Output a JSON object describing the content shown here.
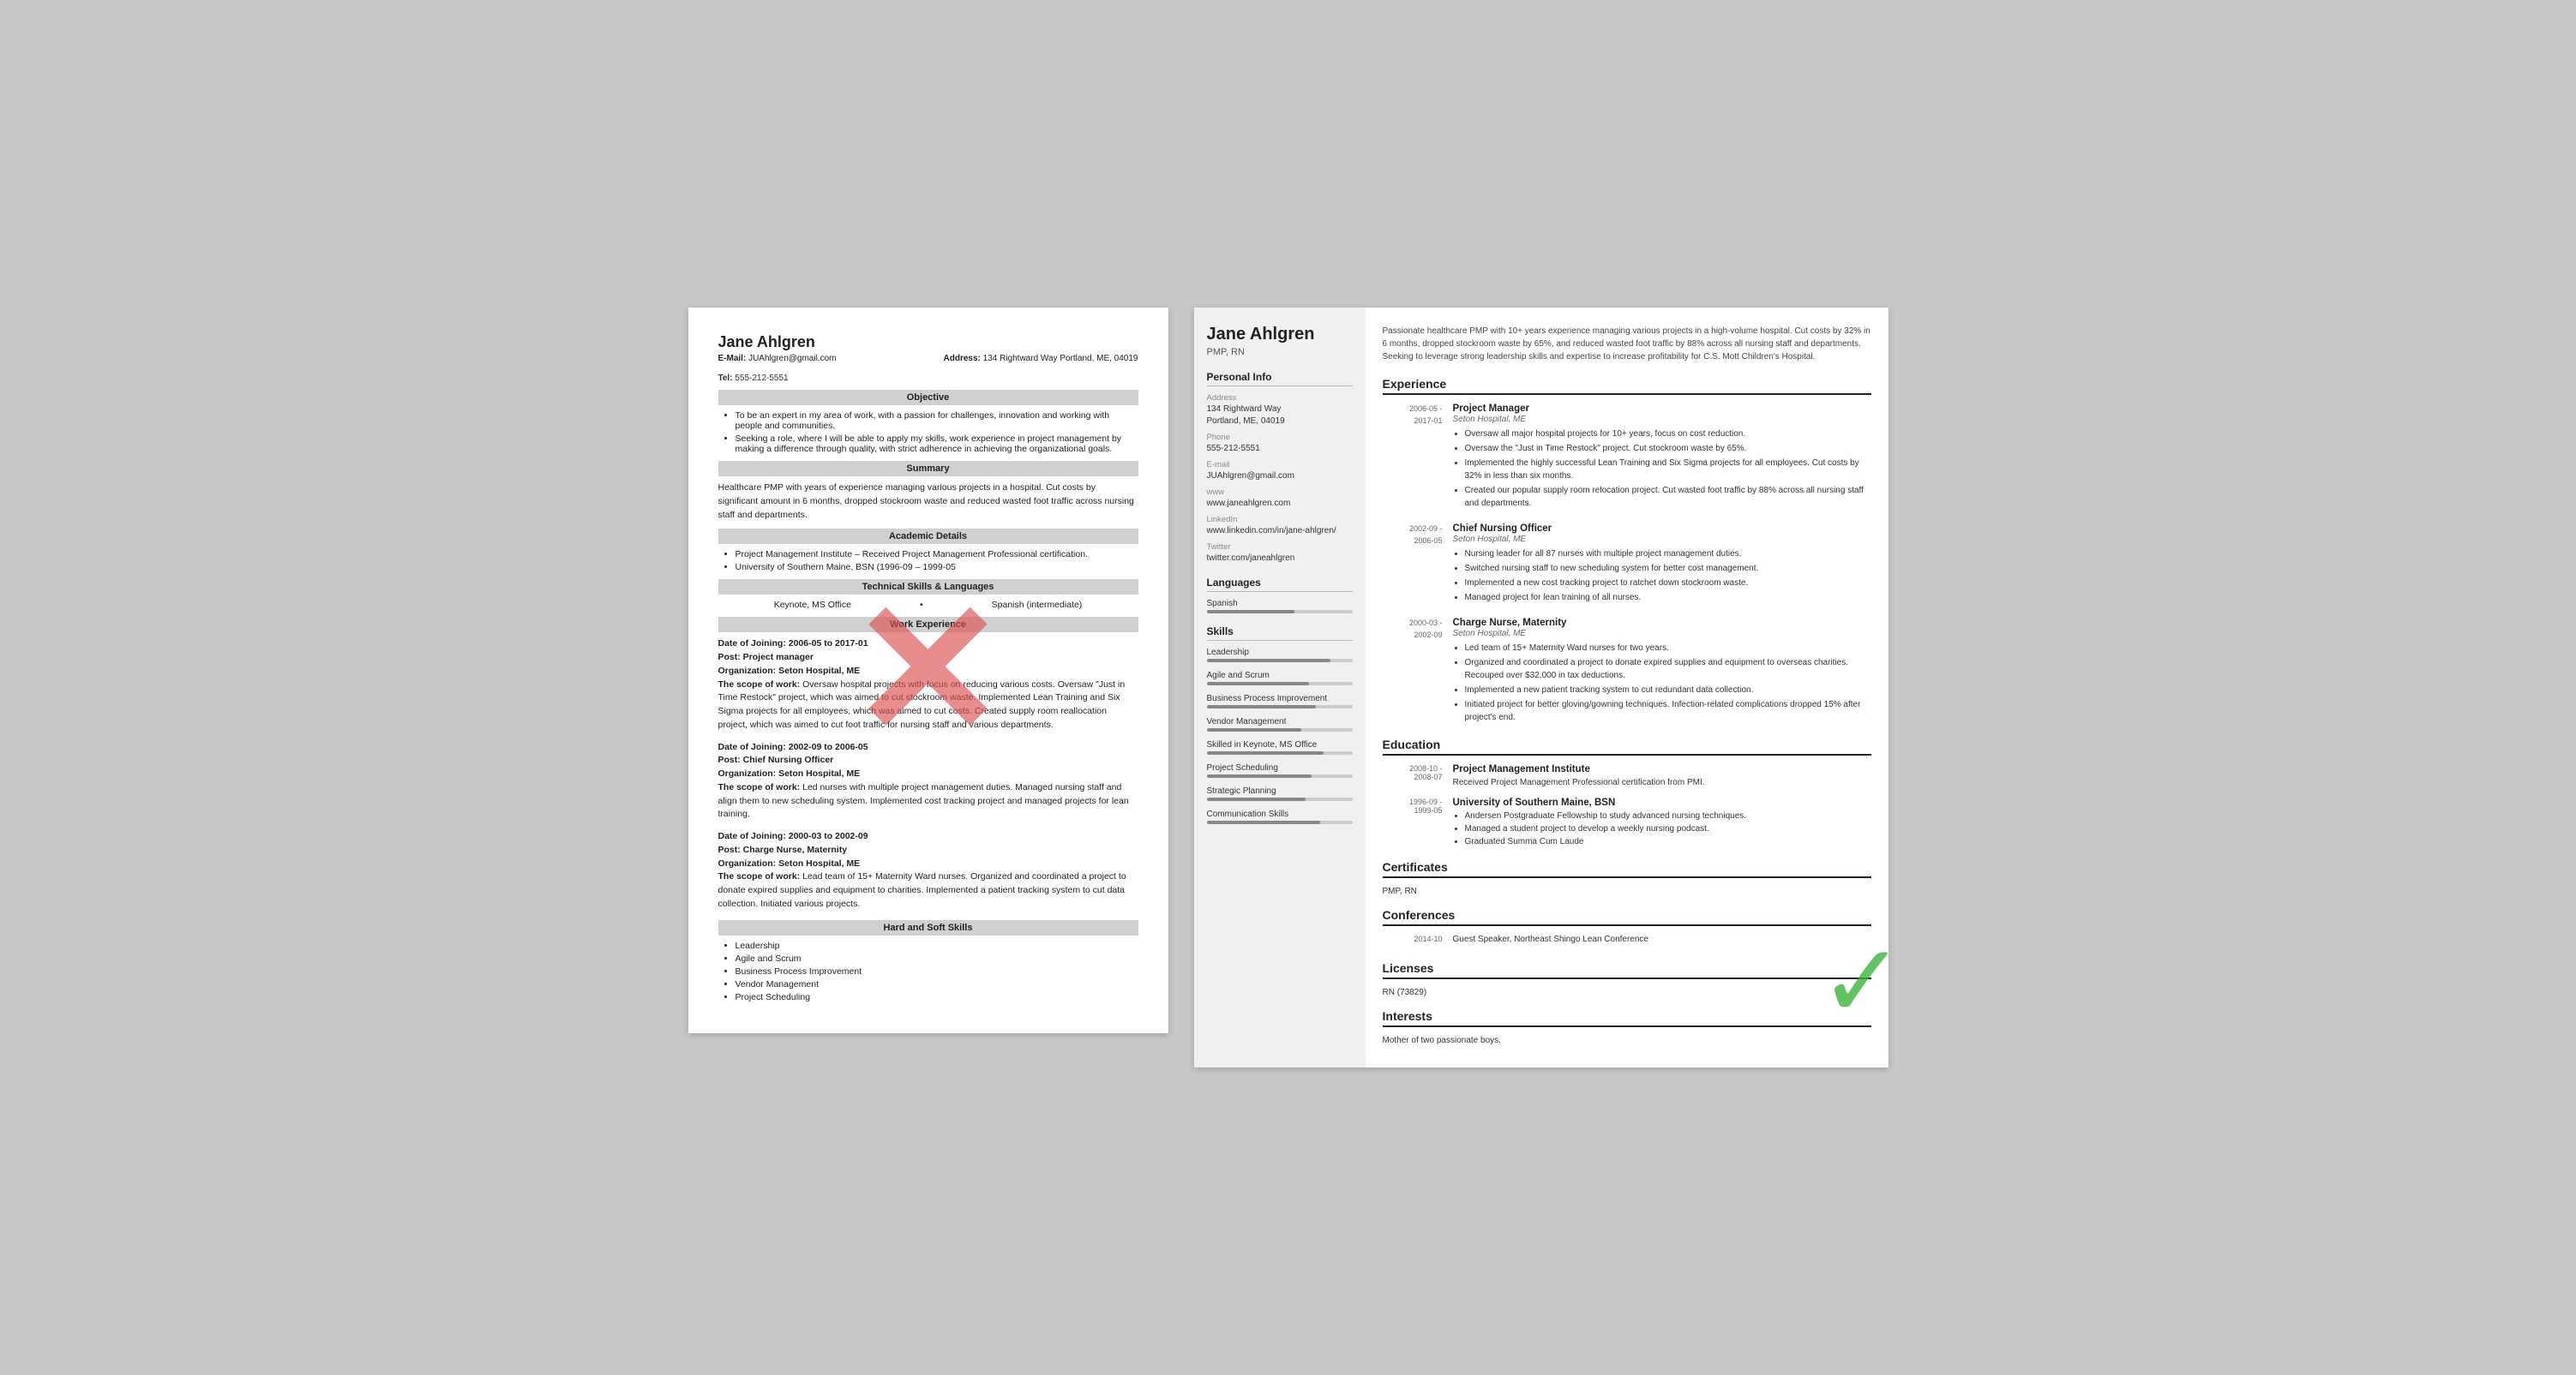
{
  "left_resume": {
    "name": "Jane Ahlgren",
    "email_label": "E-Mail:",
    "email": "JUAhlgren@gmail.com",
    "address_label": "Address:",
    "address": "134 Rightward Way Portland, ME, 04019",
    "tel_label": "Tel:",
    "tel": "555-212-5551",
    "sections": {
      "objective": {
        "title": "Objective",
        "bullets": [
          "To be an expert in my area of work, with a passion for challenges, innovation and working with people and communities.",
          "Seeking a role, where I will be able to apply my skills, work experience in project management by making a difference through quality, with strict adherence in achieving the organizational goals."
        ]
      },
      "summary": {
        "title": "Summary",
        "text": "Healthcare PMP with years of experience managing various projects in a hospital. Cut costs by significant amount in 6 months, dropped stockroom waste and reduced wasted foot traffic across nursing staff and departments."
      },
      "academic": {
        "title": "Academic Details",
        "bullets": [
          "Project Management Institute – Received Project Management Professional certification.",
          "University of Southern Maine, BSN (1996-09 – 1999-05"
        ]
      },
      "technical": {
        "title": "Technical Skills & Languages",
        "skills": [
          "Keynote, MS Office",
          "Spanish (intermediate)"
        ]
      },
      "work": {
        "title": "Work Experience",
        "entries": [
          {
            "dates": "Date of Joining: 2006-05 to 2017-01",
            "post": "Post: Project manager",
            "org": "Organization: Seton Hospital, ME",
            "scope_label": "The scope of work:",
            "scope": "Oversaw hospital projects with focus on reducing various costs. Oversaw \"Just in Time Restock\" project, which was aimed to cut stockroom waste. Implemented Lean Training and Six Sigma projects for all employees, which was aimed to cut costs. Created supply room reallocation project, which was aimed to cut foot traffic for nursing staff and various departments."
          },
          {
            "dates": "Date of Joining: 2002-09 to 2006-05",
            "post": "Post: Chief Nursing Officer",
            "org": "Organization: Seton Hospital, ME",
            "scope_label": "The scope of work:",
            "scope": "Led nurses with multiple project management duties. Managed nursing staff and align them to new scheduling system. Implemented cost tracking project and managed projects for lean training."
          },
          {
            "dates": "Date of Joining: 2000-03 to 2002-09",
            "post": "Post: Charge Nurse, Maternity",
            "org": "Organization: Seton Hospital, ME",
            "scope_label": "The scope of work:",
            "scope": "Lead team of 15+ Maternity Ward nurses. Organized and coordinated a project to donate expired supplies and equipment to charities. Implemented a patient tracking system to cut data collection. Initiated various projects."
          }
        ]
      },
      "hard_soft": {
        "title": "Hard and Soft Skills",
        "bullets": [
          "Leadership",
          "Agile and Scrum",
          "Business Process Improvement",
          "Vendor Management",
          "Project Scheduling"
        ]
      }
    }
  },
  "right_resume": {
    "name": "Jane Ahlgren",
    "title": "PMP, RN",
    "summary": "Passionate healthcare PMP with 10+ years experience managing various projects in a high-volume hospital. Cut costs by 32% in 6 months, dropped stockroom waste by 65%, and reduced wasted foot traffic by 88% across all nursing staff and departments. Seeking to leverage strong leadership skills and expertise to increase profitability for C.S. Mott Children's Hospital.",
    "personal_info": {
      "section_title": "Personal Info",
      "address_label": "Address",
      "address": "134 Rightward Way\nPortland, ME, 04019",
      "phone_label": "Phone",
      "phone": "555-212-5551",
      "email_label": "E-mail",
      "email": "JUAhlgren@gmail.com",
      "www_label": "www",
      "www": "www.janeahlgren.com",
      "linkedin_label": "LinkedIn",
      "linkedin": "www.linkedin.com/in/jane-ahlgren/",
      "twitter_label": "Twitter",
      "twitter": "twitter.com/janeahlgren"
    },
    "languages": {
      "section_title": "Languages",
      "items": [
        {
          "name": "Spanish",
          "level": 60
        }
      ]
    },
    "skills": {
      "section_title": "Skills",
      "items": [
        {
          "name": "Leadership",
          "level": 85
        },
        {
          "name": "Agile and Scrum",
          "level": 70
        },
        {
          "name": "Business Process Improvement",
          "level": 75
        },
        {
          "name": "Vendor Management",
          "level": 65
        },
        {
          "name": "Skilled in Keynote, MS Office",
          "level": 80
        },
        {
          "name": "Project Scheduling",
          "level": 72
        },
        {
          "name": "Strategic Planning",
          "level": 68
        },
        {
          "name": "Communication Skills",
          "level": 78
        }
      ]
    },
    "experience": {
      "section_title": "Experience",
      "entries": [
        {
          "date_start": "2006-05 -",
          "date_end": "2017-01",
          "title": "Project Manager",
          "org": "Seton Hospital, ME",
          "bullets": [
            "Oversaw all major hospital projects for 10+ years, focus on cost reduction.",
            "Oversaw the \"Just in Time Restock\" project. Cut stockroom waste by 65%.",
            "Implemented the highly successful Lean Training and Six Sigma projects for all employees. Cut costs by 32% in less than six months.",
            "Created our popular supply room relocation project. Cut wasted foot traffic by 88% across all nursing staff and departments."
          ]
        },
        {
          "date_start": "2002-09 -",
          "date_end": "2006-05",
          "title": "Chief Nursing Officer",
          "org": "Seton Hospital, ME",
          "bullets": [
            "Nursing leader for all 87 nurses with multiple project management duties.",
            "Switched nursing staff to new scheduling system for better cost management.",
            "Implemented a new cost tracking project to ratchet down stockroom waste.",
            "Managed project for lean training of all nurses."
          ]
        },
        {
          "date_start": "2000-03 -",
          "date_end": "2002-09",
          "title": "Charge Nurse, Maternity",
          "org": "Seton Hospital, ME",
          "bullets": [
            "Led team of 15+ Maternity Ward nurses for two years.",
            "Organized and coordinated a project to donate expired supplies and equipment to overseas charities. Recouped over $32,000 in tax deductions.",
            "Implemented a new patient tracking system to cut redundant data collection.",
            "Initiated project for better gloving/gowning techniques. Infection-related complications dropped 15% after project's end."
          ]
        }
      ]
    },
    "education": {
      "section_title": "Education",
      "entries": [
        {
          "date_start": "2008-10 -",
          "date_end": "2008-07",
          "institution": "Project Management Institute",
          "desc": "Received Project Management Professional certification from PMI.",
          "bullets": []
        },
        {
          "date_start": "1996-09 -",
          "date_end": "1999-05",
          "institution": "University of Southern Maine, BSN",
          "desc": "",
          "bullets": [
            "Andersen Postgraduate Fellowship to study advanced nursing techniques.",
            "Managed a student project to develop a weekly nursing podcast.",
            "Graduated Summa Cum Laude"
          ]
        }
      ]
    },
    "certificates": {
      "section_title": "Certificates",
      "items": [
        "PMP, RN"
      ]
    },
    "conferences": {
      "section_title": "Conferences",
      "entries": [
        {
          "date": "2014-10",
          "title": "Guest Speaker, Northeast Shingo Lean Conference"
        }
      ]
    },
    "licenses": {
      "section_title": "Licenses",
      "items": [
        "RN (73829)"
      ]
    },
    "interests": {
      "section_title": "Interests",
      "items": [
        "Mother of two passionate boys."
      ]
    }
  }
}
